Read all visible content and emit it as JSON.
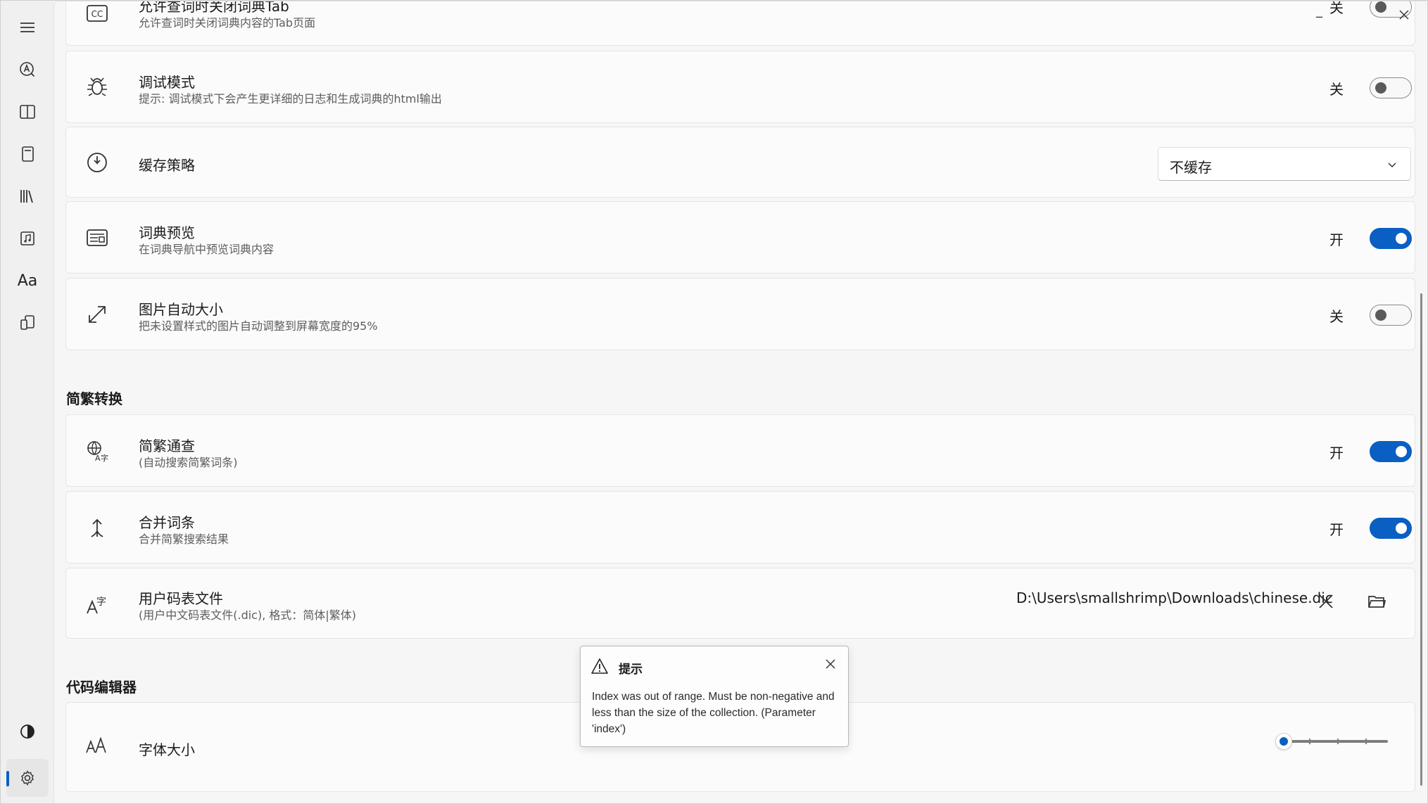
{
  "settings": {
    "close_tab": {
      "title": "允许查词时关闭词典Tab",
      "desc": "允许查词时关闭词典内容的Tab页面",
      "state_label": "关",
      "on": false
    },
    "debug": {
      "title": "调试模式",
      "desc": "提示: 调试模式下会产生更详细的日志和生成词典的html输出",
      "state_label": "关",
      "on": false
    },
    "cache": {
      "title": "缓存策略",
      "selected": "不缓存"
    },
    "preview": {
      "title": "词典预览",
      "desc": "在词典导航中预览词典内容",
      "state_label": "开",
      "on": true
    },
    "image_resize": {
      "title": "图片自动大小",
      "desc": "把未设置样式的图片自动调整到屏幕宽度的95%",
      "state_label": "关",
      "on": false
    }
  },
  "section_conversion": {
    "header": "简繁转换",
    "lookup": {
      "title": "简繁通查",
      "desc": "(自动搜索简繁词条)",
      "state_label": "开",
      "on": true
    },
    "merge": {
      "title": "合并词条",
      "desc": "合并简繁搜索结果",
      "state_label": "开",
      "on": true
    },
    "user_table": {
      "title": "用户码表文件",
      "desc": "(用户中文码表文件(.dic), 格式：简体|繁体)",
      "path": "D:\\Users\\smallshrimp\\Downloads\\chinese.dic"
    }
  },
  "section_editor": {
    "header": "代码编辑器",
    "font_size": {
      "title": "字体大小",
      "slider_value": 0
    }
  },
  "tooltip": {
    "title": "提示",
    "message": "Index was out of range. Must be non-negative and less than the size of the collection. (Parameter 'index')"
  },
  "window": {
    "minimize_glyph": "_"
  },
  "sidebar": {
    "font_item_glyph": "Aa"
  },
  "colors": {
    "accent": "#0a5fc2",
    "background": "#f6f6f6",
    "card": "#fbfbfb"
  }
}
